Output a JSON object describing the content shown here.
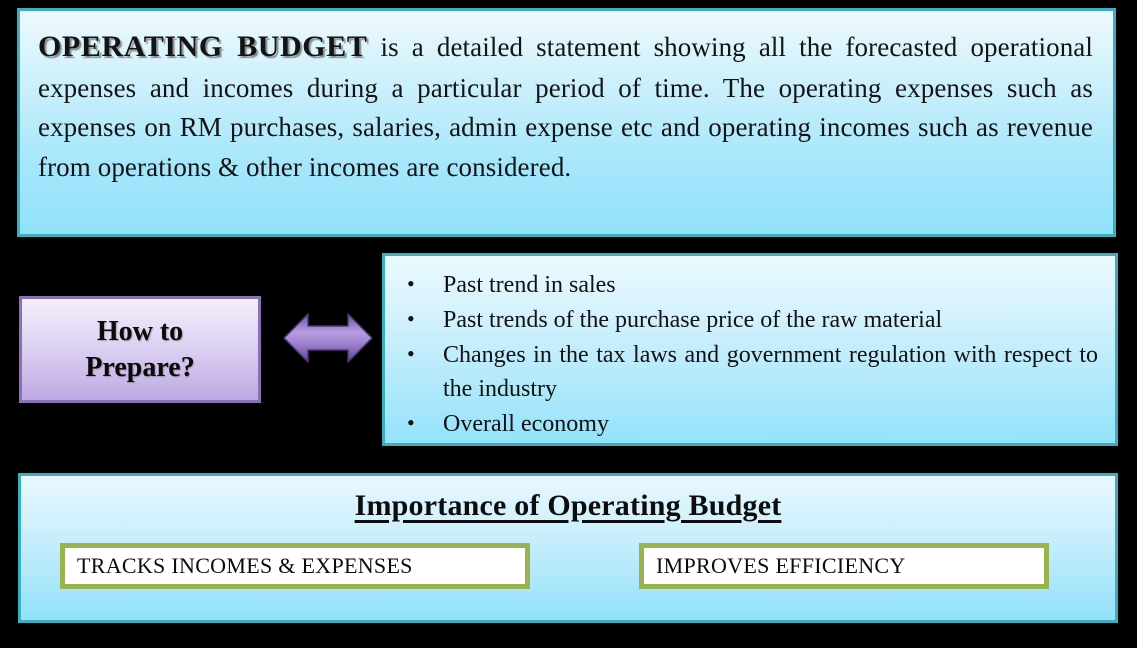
{
  "definition": {
    "lead": "OPERATING BUDGET",
    "body": " is a detailed statement showing all the forecasted operational expenses and incomes during a particular period of time. The operating expenses such as expenses on RM purchases, salaries, admin expense etc and operating incomes such as revenue from operations & other incomes are considered."
  },
  "howto": {
    "line1": "How to",
    "line2": "Prepare?"
  },
  "arrow": {
    "name": "double-headed-arrow-icon"
  },
  "bullets": {
    "marker": "•",
    "items": [
      "Past trend in sales",
      "Past trends of the purchase price of the raw material",
      "Changes in the tax laws and government regulation with respect to the industry",
      "Overall economy"
    ]
  },
  "importance": {
    "title": "Importance of Operating Budget",
    "chips": [
      "TRACKS INCOMES & EXPENSES",
      "IMPROVES EFFICIENCY"
    ]
  },
  "colors": {
    "panel_border": "#3aafc0",
    "panel_fill_top": "#eafaff",
    "panel_fill_bottom": "#8fe2fb",
    "howto_border": "#8b6fb5",
    "howto_fill_top": "#f3eefb",
    "howto_fill_bottom": "#bda8e4",
    "arrow_fill": "#9b7fc9",
    "chip_border": "#9bb34e",
    "chip_fill": "#ffffff",
    "background": "#000000",
    "text": "#121212"
  }
}
